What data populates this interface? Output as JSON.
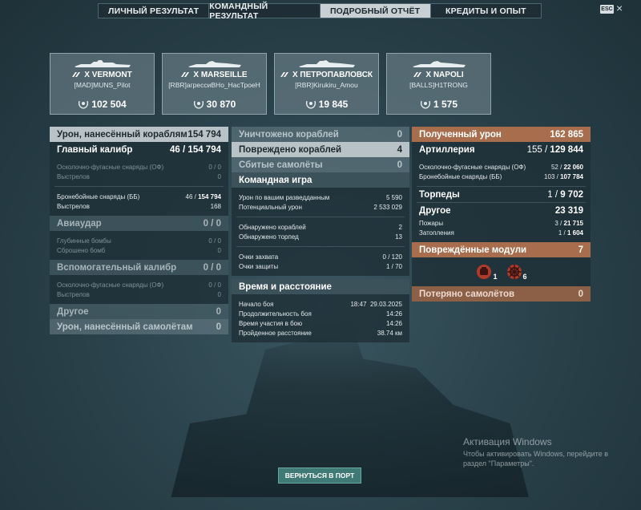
{
  "tabs": [
    "ЛИЧНЫЙ РЕЗУЛЬТАТ",
    "КОМАНДНЫЙ РЕЗУЛЬТАТ",
    "ПОДРОБНЫЙ ОТЧЁТ",
    "КРЕДИТЫ И ОПЫТ"
  ],
  "active_tab": 2,
  "esc_label": "ESC",
  "players": [
    {
      "tier": "X",
      "ship": "VERMONT",
      "player": "[MAD]MUNS_Pilot",
      "score": "102 504"
    },
    {
      "tier": "X",
      "ship": "MARSEILLE",
      "player": "[RBR]агрессиВНо_НасТроеН",
      "score": "30 870"
    },
    {
      "tier": "X",
      "ship": "ПЕТРОПАВЛОВСК",
      "player": "[RBR]Kirukiru_Amou",
      "score": "19 845"
    },
    {
      "tier": "X",
      "ship": "NAPOLI",
      "player": "[BALLS]H1TRONG",
      "score": "1 575"
    }
  ],
  "damage": {
    "title": "Урон, нанесённый кораблям",
    "total": "154 794",
    "main": {
      "title": "Главный калибр",
      "value": "46",
      "total": "154 794",
      "he": {
        "label": "Осколочно-фугасные снаряды (ОФ)",
        "value": "0 / 0"
      },
      "he_shots": {
        "label": "Выстрелов",
        "value": "0"
      },
      "ap": {
        "label": "Бронебойные снаряды (ББ)",
        "value": "46",
        "total": "154 794"
      },
      "ap_shots": {
        "label": "Выстрелов",
        "value": "168"
      }
    },
    "air": {
      "title": "Авиаудар",
      "value": "0 / 0",
      "depth": {
        "label": "Глубинные бомбы",
        "value": "0 / 0"
      },
      "dropped": {
        "label": "Сброшено бомб",
        "value": "0"
      }
    },
    "secondary": {
      "title": "Вспомогательный калибр",
      "value": "0 / 0",
      "he": {
        "label": "Осколочно-фугасные снаряды (ОФ)",
        "value": "0 / 0"
      },
      "shots": {
        "label": "Выстрелов",
        "value": "0"
      }
    },
    "other": {
      "title": "Другое",
      "value": "0"
    },
    "planes": {
      "title": "Урон, нанесённый самолётам",
      "value": "0"
    }
  },
  "center": {
    "destroyed": {
      "title": "Уничтожено кораблей",
      "value": "0"
    },
    "damaged": {
      "title": "Повреждено кораблей",
      "value": "4"
    },
    "planes_down": {
      "title": "Сбитые самолёты",
      "value": "0"
    },
    "team": {
      "title": "Командная игра",
      "spotting_damage": {
        "label": "Урон по вашим разведданным",
        "value": "5 590"
      },
      "potential": {
        "label": "Потенциальный урон",
        "value": "2 533 029"
      },
      "ships_spotted": {
        "label": "Обнаружено кораблей",
        "value": "2"
      },
      "torps_spotted": {
        "label": "Обнаружено торпед",
        "value": "13"
      },
      "capture": {
        "label": "Очки захвата",
        "value": "0 / 120"
      },
      "defense": {
        "label": "Очки защиты",
        "value": "1 / 70"
      }
    },
    "time": {
      "title": "Время и расстояние",
      "start": {
        "label": "Начало боя",
        "value": "18:47  29.03.2025"
      },
      "duration": {
        "label": "Продолжительность боя",
        "value": "14:26"
      },
      "participation": {
        "label": "Время участия в бою",
        "value": "14:26"
      },
      "distance": {
        "label": "Пройденное расстояние",
        "value": "38.74 км"
      }
    }
  },
  "received": {
    "title": "Полученный урон",
    "total": "162 865",
    "artillery": {
      "title": "Артиллерия",
      "value": "155",
      "total": "129 844",
      "he": {
        "label": "Осколочно-фугасные снаряды (ОФ)",
        "value": "52",
        "total": "22 060"
      },
      "ap": {
        "label": "Бронебойные снаряды (ББ)",
        "value": "103",
        "total": "107 784"
      }
    },
    "torpedoes": {
      "title": "Торпеды",
      "value": "1",
      "total": "9 702"
    },
    "other": {
      "title": "Другое",
      "total": "23 319",
      "fires": {
        "label": "Пожары",
        "value": "3",
        "total": "21 715"
      },
      "floods": {
        "label": "Затопления",
        "value": "1",
        "total": "1 604"
      }
    },
    "modules": {
      "title": "Повреждённые модули",
      "value": "7",
      "items": [
        {
          "icon": "engine-module-icon",
          "count": "1"
        },
        {
          "icon": "steering-module-icon",
          "count": "6"
        }
      ]
    },
    "planes_lost": {
      "title": "Потеряно самолётов",
      "value": "0"
    }
  },
  "back_button": "ВЕРНУТЬСЯ В ПОРТ",
  "watermark": {
    "title": "Активация Windows",
    "text": "Чтобы активировать Windows, перейдите в раздел \"Параметры\"."
  }
}
